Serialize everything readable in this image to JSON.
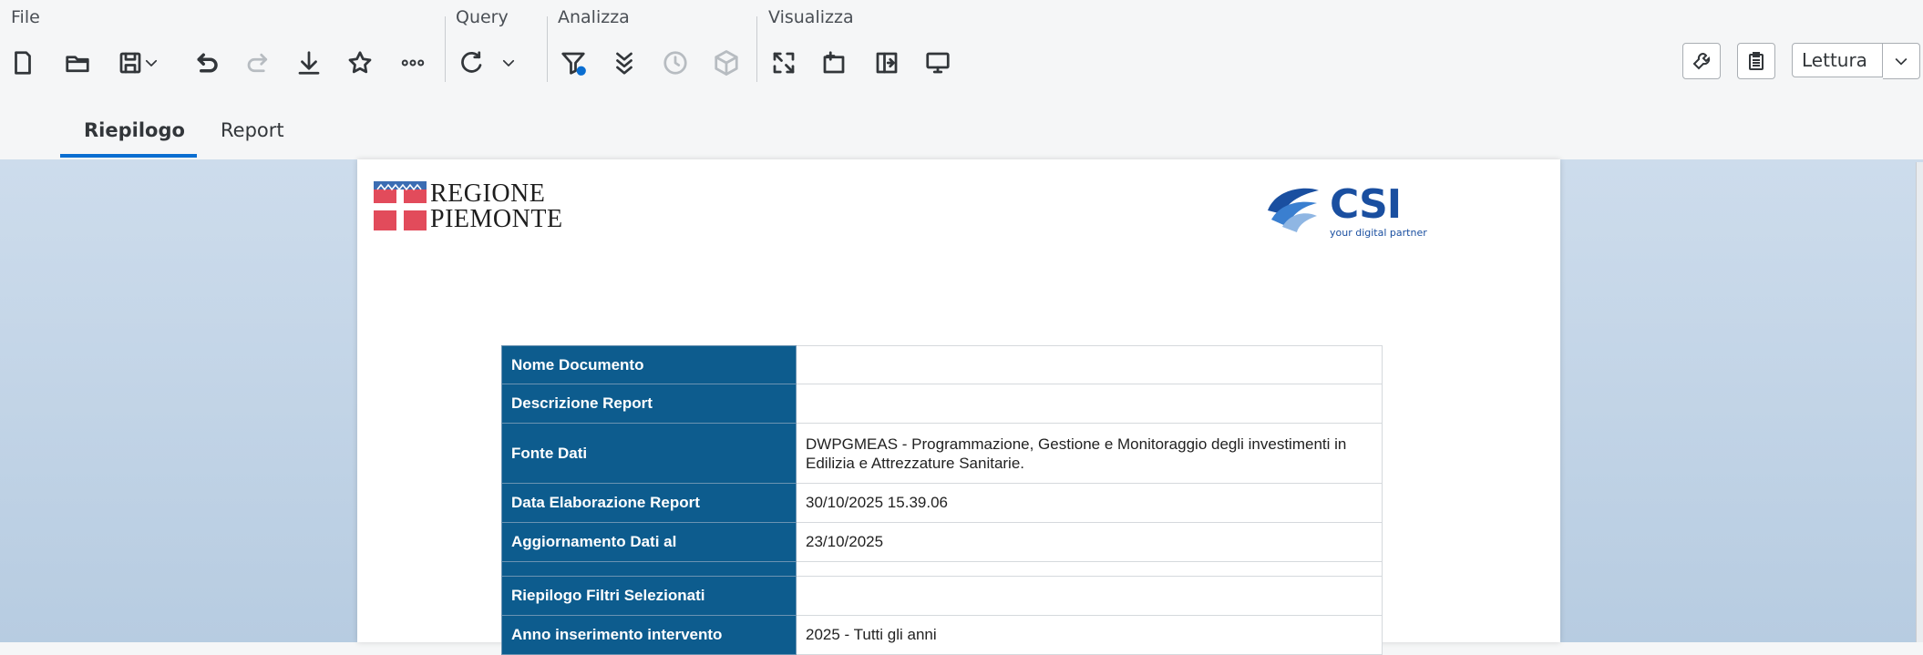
{
  "toolbar": {
    "groups": {
      "file": "File",
      "query": "Query",
      "analyze": "Analizza",
      "view": "Visualizza"
    },
    "mode": "Lettura"
  },
  "tabs": [
    {
      "label": "Riepilogo",
      "active": true
    },
    {
      "label": "Report",
      "active": false
    }
  ],
  "document": {
    "logos": {
      "regione": [
        "REGIONE",
        "PIEMONTE"
      ],
      "csi_name": "CSI",
      "csi_tagline": "your digital partner"
    },
    "rows": [
      {
        "label": "Nome Documento",
        "value": ""
      },
      {
        "label": "Descrizione Report",
        "value": ""
      },
      {
        "label": "Fonte Dati",
        "value": "DWPGMEAS - Programmazione, Gestione e Monitoraggio degli investimenti in Edilizia e Attrezzature Sanitarie."
      },
      {
        "label": "Data Elaborazione Report",
        "value": "30/10/2025 15.39.06"
      },
      {
        "label": "Aggiornamento Dati al",
        "value": "23/10/2025"
      },
      {
        "label": "",
        "value": ""
      },
      {
        "label": "Riepilogo Filtri Selezionati",
        "value": ""
      },
      {
        "label": "Anno inserimento intervento",
        "value": "2025 - Tutti gli anni"
      }
    ]
  },
  "colors": {
    "header_blue": "#0d5c8e",
    "accent": "#0a6ed1"
  }
}
